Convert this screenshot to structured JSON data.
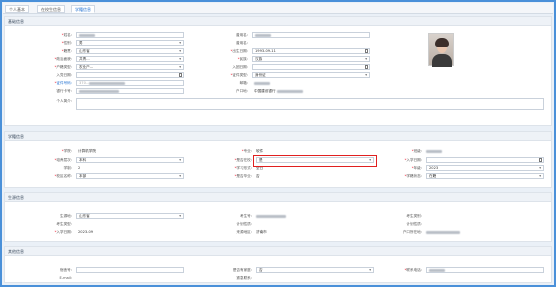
{
  "tabs": [
    {
      "label": "个人基本",
      "active": false
    },
    {
      "label": "在校生信息",
      "active": false
    },
    {
      "label": "学籍信息",
      "active": true
    }
  ],
  "sections": {
    "basic": "基础信息",
    "study": "学籍信息",
    "enroll": "生源信息",
    "other": "其他信息"
  },
  "basic": {
    "name_label": "姓名:",
    "former_name_label": "曾用名:",
    "gender_label": "性别:",
    "gender_value": "男",
    "nation_label": "籍贯:",
    "nation_value": "山东省",
    "birth_label": "出生日期:",
    "birth_value": "1993-09-11",
    "political_label": "政治面貌:",
    "political_value": "共青...",
    "ethnic_label": "民族:",
    "ethnic_value": "汉族",
    "hukou_label": "户籍类型:",
    "hukou_value": "农业户...",
    "enroll_date_label": "入团日期:",
    "party_label": "入党日期:",
    "id_type_label": "证件类型:",
    "id_type_value": "身份证",
    "id_no_label": "证件号码:",
    "id_no_value": "370...",
    "email_label": "邮箱:",
    "bank_label": "银行卡号:",
    "account_label": "户口地:",
    "account_value": "中国建设银行",
    "remark_label": "个人简介:"
  },
  "study": {
    "college_label": "学院:",
    "college_value": "计算机学院",
    "major_label": "专业:",
    "major_value": "软件",
    "class_label": "班级:",
    "level_label": "培养层次:",
    "level_value": "本科",
    "atschool_label": "是否在校:",
    "atschool_value": "是",
    "enter_date_label": "入学日期:",
    "length_label": "学制:",
    "length_value": "2",
    "study_type_label": "学习形式:",
    "study_type_value": "全日",
    "grade_label": "年级:",
    "grade_value": "2023",
    "campus_label": "校区名称:",
    "campus_value": "本部",
    "status_label": "是否毕业:",
    "status_value": "否",
    "xj_label": "学籍状态:",
    "xj_value": "在籍"
  },
  "enroll": {
    "source_label": "生源地:",
    "source_value": "山东省",
    "exam_no_label": "考生号:",
    "exam_type_label": "考生类别:",
    "plan_label": "计划性质:",
    "ks_label": "考生类型:",
    "enroll_date_label": "入学日期:",
    "enroll_date_value": "2023-09",
    "from_label": "来源地区:",
    "from_value": "济南市",
    "hukou_label": "户口所在地:"
  },
  "other": {
    "dorm_label": "宿舍号:",
    "phone_label": "是否有家庭:",
    "phone_value": "否",
    "contact_label": "联系电话:",
    "email_label": "E-mail:",
    "emergency_label": "紧急联系:"
  }
}
